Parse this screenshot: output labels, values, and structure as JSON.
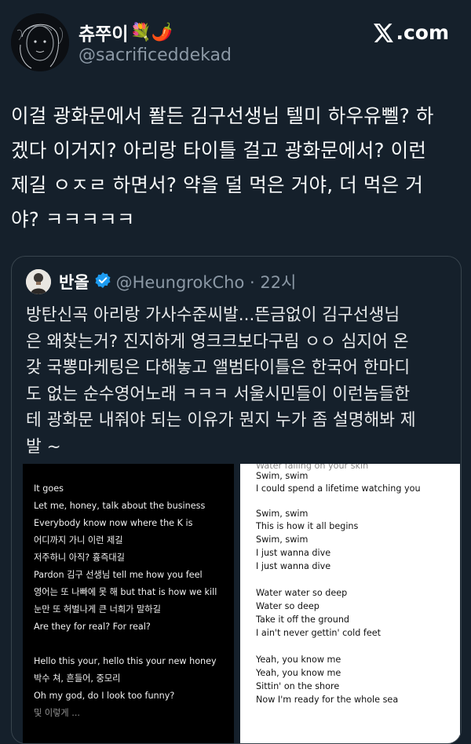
{
  "author": {
    "display_name": "츄쭈이",
    "emoji": "💐🌶️",
    "handle": "@sacrificeddekad"
  },
  "brand": {
    "label": ".com"
  },
  "tweet": {
    "lines": [
      "이걸 광화문에서 퐐든 김구선생님 텔미 하우유뻴? 하",
      "겠다 이거지? 아리랑 타이틀 걸고 광화문에서? 이런",
      "제길 ㅇㅈㄹ 하면서? 약을 덜 먹은 거야, 더 먹은 거",
      "야? ㅋㅋㅋㅋㅋ"
    ]
  },
  "quote": {
    "display_name": "반올",
    "handle_time": "@HeungrokCho · 22시",
    "lines": [
      "방탄신곡 아리랑 가사수준씨발...뜬금없이 김구선생님",
      "은 왜찾는거? 진지하게 영크크보다구림 ㅇㅇ 심지어 온",
      "갖 국뽕마케팅은 다해놓고 앨범타이틀은 한국어 한마디",
      "도 없는 순수영어노래 ㅋㅋㅋ 서울시민들이 이런놈들한",
      "테 광화문 내줘야 되는 이유가 뭔지 누가 좀 설명해봐 제",
      "발 ~"
    ],
    "media_left_lyrics": [
      "It goes",
      "Let me, honey, talk about the business",
      "Everybody know now where the K is",
      "어디까지 가니 이런 제길",
      "저주하니 아직? 흉즉대길",
      "Pardon 김구 선생님 tell me how you feel",
      "영어는 또 나빠에 못 해 but that is how we kill",
      "눈만 또 허벌나게 큰 너희가 말하길",
      "Are they for real? For real?",
      "",
      "Hello this your, hello this your new honey",
      "박수 쳐, 흔들어, 중모리",
      "Oh my god, do I look too funny?",
      "및 이렇게 ..."
    ],
    "media_right_lyrics": [
      "Water falling on your skin",
      "Swim, swim",
      "I could spend a lifetime watching you",
      "",
      "Swim, swim",
      "This is how it all begins",
      "Swim, swim",
      "I just wanna dive",
      "I just wanna dive",
      "",
      "Water water so deep",
      "Water so deep",
      "Take it off the ground",
      "I ain't never gettin' cold feet",
      "",
      "Yeah, you know me",
      "Yeah, you know me",
      "Sittin' on the shore",
      "Now I'm ready for the whole sea"
    ]
  },
  "colors": {
    "background": "#15202b",
    "text": "#e7e9ea",
    "secondary": "#8b98a5",
    "verified": "#1d9bf0",
    "border": "#38444d"
  }
}
